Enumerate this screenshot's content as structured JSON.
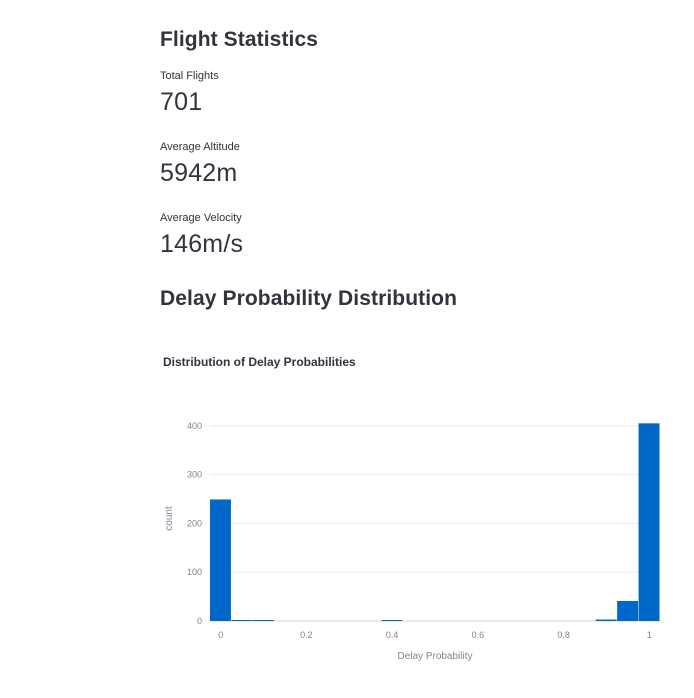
{
  "stats": {
    "heading": "Flight Statistics",
    "metrics": [
      {
        "label": "Total Flights",
        "value": "701"
      },
      {
        "label": "Average Altitude",
        "value": "5942m"
      },
      {
        "label": "Average Velocity",
        "value": "146m/s"
      }
    ]
  },
  "delay": {
    "heading": "Delay Probability Distribution"
  },
  "chart_data": {
    "type": "bar",
    "title": "Distribution of Delay Probabilities",
    "xlabel": "Delay Probability",
    "ylabel": "count",
    "xlim": [
      -0.025,
      1.025
    ],
    "ylim": [
      0,
      420
    ],
    "x_ticks": [
      0,
      0.2,
      0.4,
      0.6,
      0.8,
      1
    ],
    "x_tick_labels": [
      "0",
      "0.2",
      "0.4",
      "0.6",
      "0.8",
      "1"
    ],
    "y_ticks": [
      0,
      100,
      200,
      300,
      400
    ],
    "y_tick_labels": [
      "0",
      "100",
      "200",
      "300",
      "400"
    ],
    "bin_width": 0.05,
    "bins": [
      {
        "start": -0.025,
        "end": 0.025,
        "count": 249
      },
      {
        "start": 0.025,
        "end": 0.075,
        "count": 1
      },
      {
        "start": 0.075,
        "end": 0.125,
        "count": 1
      },
      {
        "start": 0.375,
        "end": 0.425,
        "count": 1
      },
      {
        "start": 0.875,
        "end": 0.925,
        "count": 3
      },
      {
        "start": 0.925,
        "end": 0.975,
        "count": 41
      },
      {
        "start": 0.975,
        "end": 1.025,
        "count": 405
      }
    ],
    "bar_color": "#0068c9",
    "grid": true
  }
}
